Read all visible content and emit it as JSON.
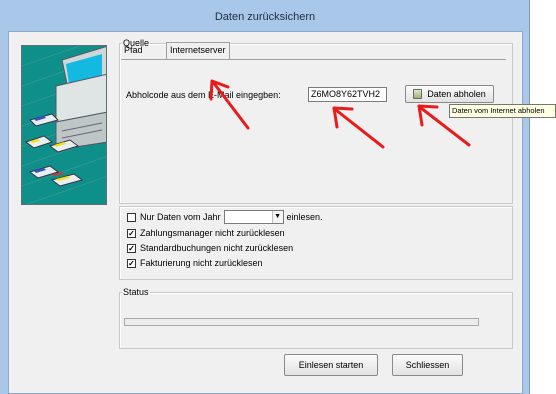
{
  "window": {
    "title": "Daten zurücksichern"
  },
  "quelle": {
    "legend": "Quelle",
    "tabs": [
      {
        "label": "Pfad",
        "active": false
      },
      {
        "label": "Internetserver",
        "active": true
      }
    ],
    "code_label": "Abholcode aus dem E-Mail eingegben:",
    "code_value": "Z6MO8Y62TVH2",
    "fetch_button": "Daten abholen",
    "fetch_tooltip": "Daten vom Internet abholen"
  },
  "options": {
    "year_label": "Nur Daten vom Jahr",
    "year_suffix": "einlesen.",
    "year_checked": false,
    "items": [
      {
        "label": "Zahlungsmanager nicht zurücklesen",
        "checked": true
      },
      {
        "label": "Standardbuchungen nicht zurücklesen",
        "checked": true
      },
      {
        "label": "Fakturierung nicht zurücklesen",
        "checked": true
      }
    ]
  },
  "status": {
    "legend": "Status",
    "progress": 0
  },
  "buttons": {
    "start": "Einlesen starten",
    "close": "Schliessen"
  },
  "colors": {
    "annotation_arrow": "#e81c1c",
    "title_bar": "#a9c7e8",
    "illustration_bg": "#0f8f8a"
  }
}
